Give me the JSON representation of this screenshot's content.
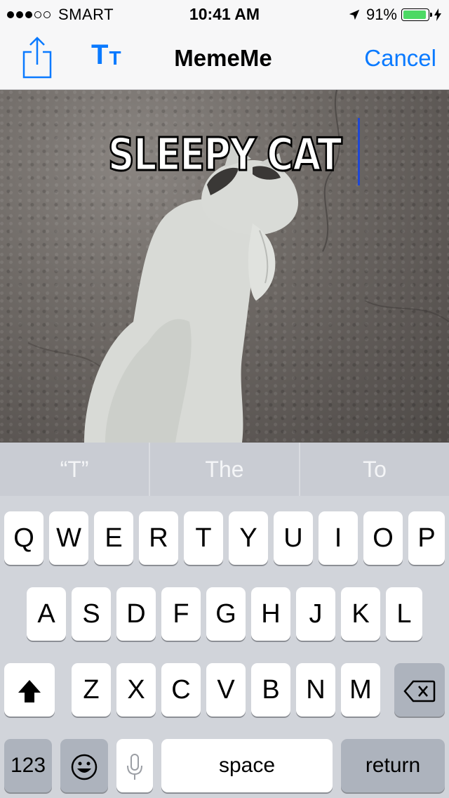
{
  "status_bar": {
    "signal_dots": [
      "filled",
      "filled",
      "filled",
      "empty",
      "empty"
    ],
    "carrier": "SMART",
    "time": "10:41 AM",
    "battery": "91%",
    "battery_level": 0.91
  },
  "nav": {
    "title": "MemeMe",
    "font_button": {
      "big": "T",
      "small": "T"
    },
    "cancel_label": "Cancel",
    "accent_color": "#0a7aff"
  },
  "meme": {
    "top_text": "SLEEPY CAT",
    "bottom_text": ""
  },
  "keyboard": {
    "predictions": [
      "“T”",
      "The",
      "To"
    ],
    "row1": [
      "Q",
      "W",
      "E",
      "R",
      "T",
      "Y",
      "U",
      "I",
      "O",
      "P"
    ],
    "row2": [
      "A",
      "S",
      "D",
      "F",
      "G",
      "H",
      "J",
      "K",
      "L"
    ],
    "row3": [
      "Z",
      "X",
      "C",
      "V",
      "B",
      "N",
      "M"
    ],
    "numbers_label": "123",
    "space_label": "space",
    "return_label": "return"
  }
}
